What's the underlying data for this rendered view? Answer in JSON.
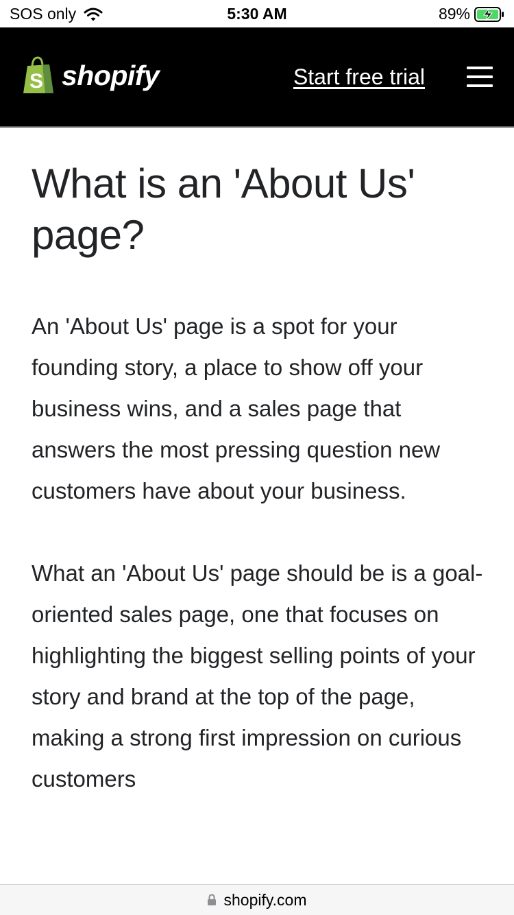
{
  "status_bar": {
    "carrier": "SOS only",
    "time": "5:30 AM",
    "battery": "89%"
  },
  "header": {
    "brand": "shopify",
    "cta": "Start free trial",
    "logo_icon": "shopify-bag-icon",
    "menu_icon": "hamburger-menu-icon",
    "background": "#000000",
    "brand_green": "#95bf47"
  },
  "article": {
    "title": "What is an 'About Us' page?",
    "paragraphs": [
      "An 'About Us' page is a spot for your founding story, a place to show off your business wins, and a sales page that answers the most pressing question new customers have about your business.",
      "What an 'About Us' page should be is a goal-oriented sales page, one that focuses on highlighting the biggest selling points of your story and brand at the top of the page, making a strong first impression on curious customers"
    ]
  },
  "url_bar": {
    "url": "shopify.com",
    "icon": "lock-icon"
  }
}
